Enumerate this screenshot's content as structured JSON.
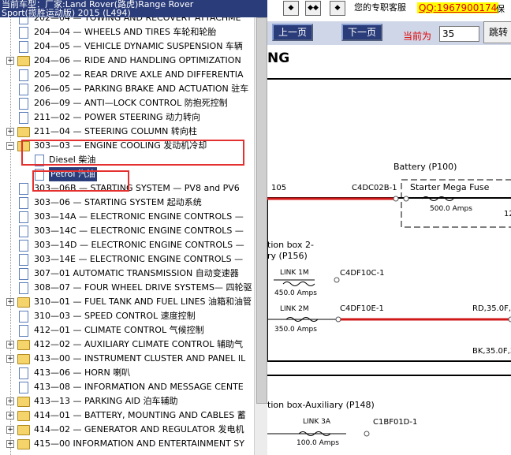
{
  "header": {
    "line1": "当前车型：厂家:Land Rover(路虎)Range Rover",
    "line2": "Sport(揽胜运动版) 2015 (L494)"
  },
  "tree": {
    "items": [
      {
        "label": "202—04 — TOWING AND RECOVERY ATTACHME",
        "type": "page"
      },
      {
        "label": "204—04 — WHEELS AND TIRES 车轮和轮胎",
        "type": "page"
      },
      {
        "label": "204—05 — VEHICLE DYNAMIC SUSPENSION 车辆",
        "type": "page"
      },
      {
        "label": "204—06 — RIDE AND HANDLING OPTIMIZATION",
        "type": "folder"
      },
      {
        "label": "205—02 — REAR DRIVE AXLE AND DIFFERENTIA",
        "type": "page"
      },
      {
        "label": "206—05 — PARKING BRAKE AND ACTUATION 驻车",
        "type": "page"
      },
      {
        "label": "206—09 — ANTI—LOCK CONTROL 防抱死控制",
        "type": "page"
      },
      {
        "label": "211—02 — POWER STEERING 动力转向",
        "type": "page"
      },
      {
        "label": "211—04 — STEERING COLUMN 转向柱",
        "type": "folder"
      },
      {
        "label": "303—03 — ENGINE COOLING 发动机冷却",
        "type": "folder-open"
      },
      {
        "label": "Diesel 柴油",
        "type": "child"
      },
      {
        "label": "Petrol 汽油",
        "type": "child-selected"
      },
      {
        "label": "303—06B — STARTING SYSTEM — PV8 and PV6",
        "type": "page"
      },
      {
        "label": "303—06 — STARTING SYSTEM 起动系统",
        "type": "page"
      },
      {
        "label": "303—14A — ELECTRONIC ENGINE CONTROLS —",
        "type": "page"
      },
      {
        "label": "303—14C — ELECTRONIC ENGINE CONTROLS —",
        "type": "page"
      },
      {
        "label": "303—14D — ELECTRONIC ENGINE CONTROLS —",
        "type": "page"
      },
      {
        "label": "303—14E — ELECTRONIC ENGINE CONTROLS —",
        "type": "page"
      },
      {
        "label": "307—01 AUTOMATIC TRANSMISSION 自动变速器",
        "type": "page"
      },
      {
        "label": "308—07 — FOUR WHEEL DRIVE SYSTEMS— 四轮驱",
        "type": "page"
      },
      {
        "label": "310—01 — FUEL TANK AND FUEL LINES 油箱和油管",
        "type": "folder"
      },
      {
        "label": "310—03 — SPEED CONTROL 速度控制",
        "type": "page"
      },
      {
        "label": "412—01 — CLIMATE CONTROL 气候控制",
        "type": "page"
      },
      {
        "label": "412—02 — AUXILIARY CLIMATE CONTROL 辅助气",
        "type": "folder"
      },
      {
        "label": "413—00 — INSTRUMENT CLUSTER AND PANEL IL",
        "type": "folder"
      },
      {
        "label": "413—06 — HORN 喇叭",
        "type": "page"
      },
      {
        "label": "413—08 — INFORMATION AND MESSAGE CENTE",
        "type": "page"
      },
      {
        "label": "413—13 — PARKING AID 泊车辅助",
        "type": "folder"
      },
      {
        "label": "414—01 — BATTERY, MOUNTING AND CABLES 蓄",
        "type": "folder"
      },
      {
        "label": "414—02 — GENERATOR AND REGULATOR 发电机",
        "type": "folder"
      },
      {
        "label": "415—00 INFORMATION AND ENTERTAINMENT SY",
        "type": "folder"
      }
    ]
  },
  "toolbar": {
    "service_text": "您的专职客服",
    "qq": "QQ:1967900174",
    "qq_tail": "保",
    "prev": "上一页",
    "next": "下一页",
    "current_label": "当前为",
    "current_page": "35",
    "jump": "跳转"
  },
  "diagram": {
    "title_fragment": "NG",
    "battery": "Battery (P100)",
    "wire105": "105",
    "c4dc02b": "C4DC02B-1",
    "starter_fuse": "Starter Mega Fuse",
    "amps500": "500.0 Amps",
    "box2_line1": "tion box 2-",
    "box2_line2": "ry (P156)",
    "link1m": "LINK 1M",
    "amps450": "450.0 Amps",
    "c4df10c": "C4DF10C-1",
    "link2m": "LINK 2M",
    "amps350": "350.0 Amps",
    "c4df10e": "C4DF10E-1",
    "rd35": "RD,35.0F,1",
    "bk35": "BK,35.0F,3",
    "aux_box": "tion box-Auxiliary (P148)",
    "link3a": "LINK 3A",
    "c1bf01d": "C1BF01D-1",
    "amps100": "100.0 Amps",
    "frag12": "12"
  },
  "colors": {
    "wire_red": "#d01818",
    "highlight": "#e53030",
    "navy": "#2a3c7a"
  }
}
